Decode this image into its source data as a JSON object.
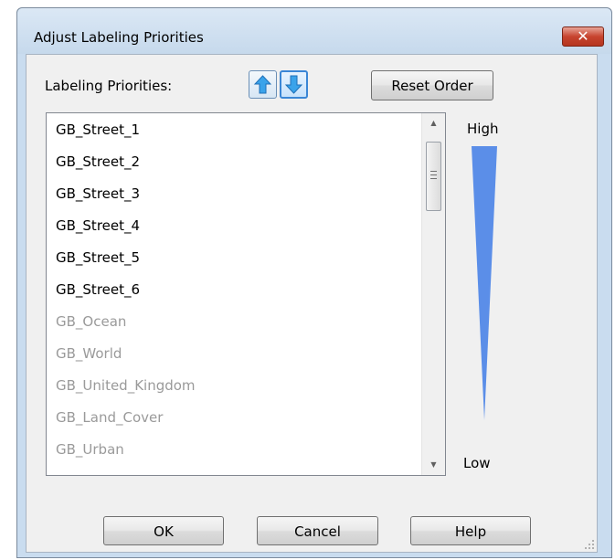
{
  "window": {
    "title": "Adjust Labeling Priorities",
    "close_label": "✕"
  },
  "toolbar": {
    "priorities_label": "Labeling Priorities:",
    "move_up_icon": "arrow-up-icon",
    "move_down_icon": "arrow-down-icon",
    "reset_order_label": "Reset Order"
  },
  "list": {
    "items": [
      {
        "label": "GB_Street_1",
        "enabled": true
      },
      {
        "label": "GB_Street_2",
        "enabled": true
      },
      {
        "label": "GB_Street_3",
        "enabled": true
      },
      {
        "label": "GB_Street_4",
        "enabled": true
      },
      {
        "label": "GB_Street_5",
        "enabled": true
      },
      {
        "label": "GB_Street_6",
        "enabled": true
      },
      {
        "label": "GB_Ocean",
        "enabled": false
      },
      {
        "label": "GB_World",
        "enabled": false
      },
      {
        "label": "GB_United_Kingdom",
        "enabled": false
      },
      {
        "label": "GB_Land_Cover",
        "enabled": false
      },
      {
        "label": "GB_Urban",
        "enabled": false
      }
    ]
  },
  "priority_scale": {
    "high_label": "High",
    "low_label": "Low",
    "color": "#5b8ee8"
  },
  "footer": {
    "ok_label": "OK",
    "cancel_label": "Cancel",
    "help_label": "Help"
  },
  "colors": {
    "accent": "#3a86d6",
    "close": "#c7442f",
    "disabled_text": "#9a9a9a"
  }
}
